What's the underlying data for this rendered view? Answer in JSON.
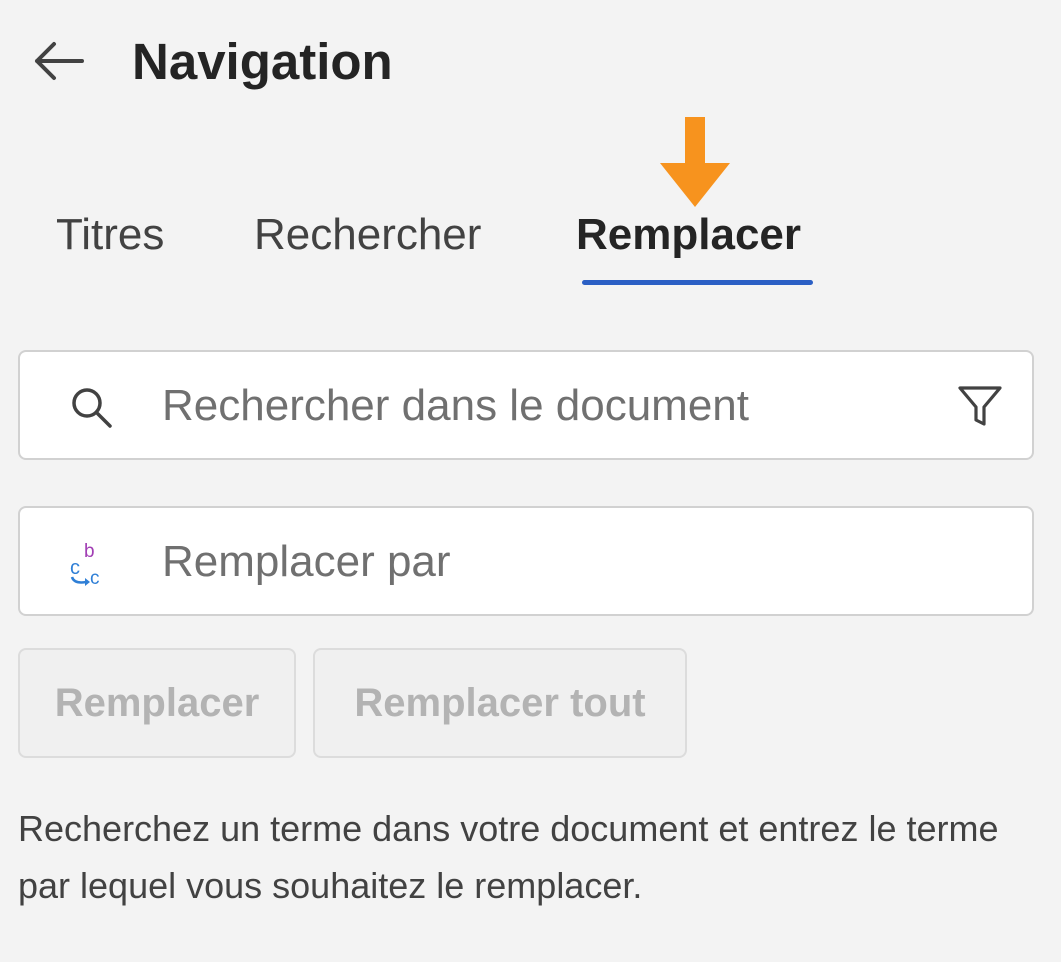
{
  "header": {
    "back_icon": "arrow-left-icon",
    "title": "Navigation"
  },
  "annotation": {
    "icon": "arrow-down-icon",
    "color": "#f7931e"
  },
  "tabs": [
    {
      "label": "Titres",
      "active": false
    },
    {
      "label": "Rechercher",
      "active": false
    },
    {
      "label": "Remplacer",
      "active": true
    }
  ],
  "search": {
    "icon": "search-icon",
    "placeholder": "Rechercher dans le document",
    "value": "",
    "filter_icon": "filter-icon"
  },
  "replace": {
    "icon": "replace-icon",
    "placeholder": "Remplacer par",
    "value": ""
  },
  "buttons": {
    "replace_label": "Remplacer",
    "replace_all_label": "Remplacer tout",
    "enabled": false
  },
  "help_text": "Recherchez un terme dans votre document et entrez le terme par lequel vous souhaitez le remplacer.",
  "colors": {
    "accent": "#2b5fc4",
    "annotation": "#f7931e"
  }
}
